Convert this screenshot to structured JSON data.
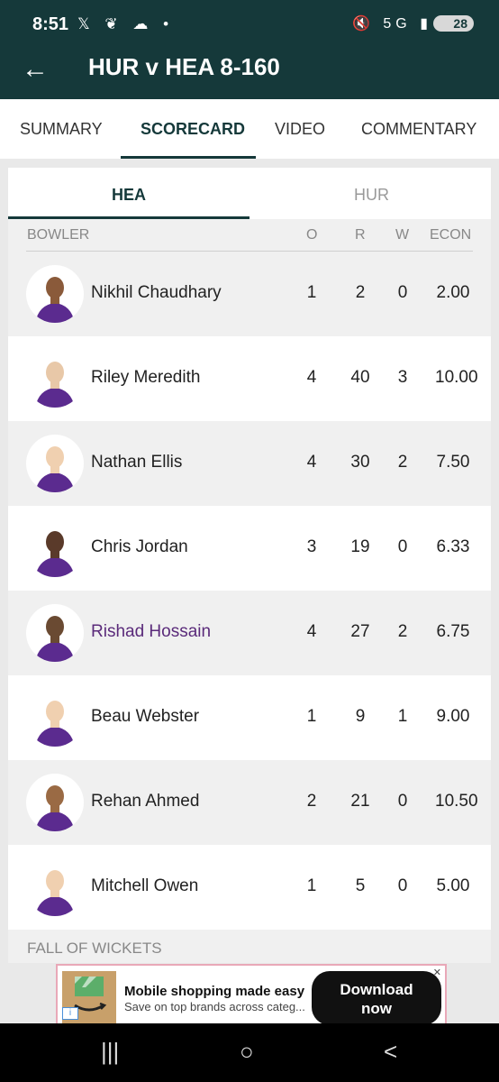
{
  "status": {
    "time": "8:51",
    "left_icons": "𝕏 ❦ ☁ •",
    "right_icons": "🔇 5G ▮",
    "battery": "28"
  },
  "appbar": {
    "title": "HUR v HEA 8-160"
  },
  "tabs": [
    {
      "label": "SUMMARY"
    },
    {
      "label": "SCORECARD"
    },
    {
      "label": "VIDEO"
    },
    {
      "label": "COMMENTARY"
    }
  ],
  "team_tabs": [
    {
      "label": "HEA"
    },
    {
      "label": "HUR"
    }
  ],
  "columns": {
    "bowler": "BOWLER",
    "o": "O",
    "r": "R",
    "w": "W",
    "econ": "ECON"
  },
  "bowlers": [
    {
      "name": "Nikhil Chaudhary",
      "o": "1",
      "r": "2",
      "w": "0",
      "econ": "2.00"
    },
    {
      "name": "Riley Meredith",
      "o": "4",
      "r": "40",
      "w": "3",
      "econ": "10.00"
    },
    {
      "name": "Nathan Ellis",
      "o": "4",
      "r": "30",
      "w": "2",
      "econ": "7.50"
    },
    {
      "name": "Chris Jordan",
      "o": "3",
      "r": "19",
      "w": "0",
      "econ": "6.33"
    },
    {
      "name": "Rishad Hossain",
      "o": "4",
      "r": "27",
      "w": "2",
      "econ": "6.75"
    },
    {
      "name": "Beau Webster",
      "o": "1",
      "r": "9",
      "w": "1",
      "econ": "9.00"
    },
    {
      "name": "Rehan Ahmed",
      "o": "2",
      "r": "21",
      "w": "0",
      "econ": "10.50"
    },
    {
      "name": "Mitchell Owen",
      "o": "1",
      "r": "5",
      "w": "0",
      "econ": "5.00"
    }
  ],
  "section_next": "FALL OF WICKETS",
  "ad": {
    "headline": "Mobile shopping made easy",
    "sub": "Save on top brands across categ...",
    "cta_line1": "Download",
    "cta_line2": "now",
    "info": "i",
    "close": "✕"
  },
  "nav": {
    "recents": "|||",
    "home": "○",
    "back": "<"
  },
  "colors": {
    "header": "#15393a",
    "highlight_name": "#5a2a7a",
    "jersey": "#5b2b8f"
  }
}
